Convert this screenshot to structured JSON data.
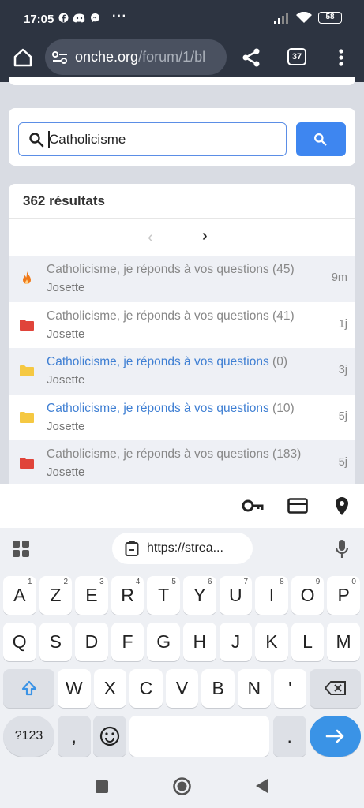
{
  "status_bar": {
    "time": "17:05",
    "battery": "58",
    "notification_icons": [
      "facebook-icon",
      "discord-icon",
      "messenger-icon"
    ],
    "more": "···"
  },
  "browser": {
    "url_host": "onche.org",
    "url_path": "/forum/1/bl",
    "tab_count": "37"
  },
  "search": {
    "value": "Catholicisme"
  },
  "results": {
    "count_label": "362 résultats",
    "pager_prev": "‹",
    "pager_next": "›",
    "topics": [
      {
        "icon": "fire-icon",
        "color": "#f07a1a",
        "title": "Catholicisme, je réponds à vos questions",
        "count": "(45)",
        "author": "Josette",
        "age": "9m",
        "unread": false
      },
      {
        "icon": "folder-red-icon",
        "color": "#e0443a",
        "title": "Catholicisme, je réponds à vos questions",
        "count": "(41)",
        "author": "Josette",
        "age": "1j",
        "unread": false
      },
      {
        "icon": "folder-yellow-icon",
        "color": "#f5c842",
        "title": "Catholicisme, je réponds à vos questions",
        "count": "(0)",
        "author": "Josette",
        "age": "3j",
        "unread": true
      },
      {
        "icon": "folder-yellow-icon",
        "color": "#f5c842",
        "title": "Catholicisme, je réponds à vos questions",
        "count": "(10)",
        "author": "Josette",
        "age": "5j",
        "unread": true
      },
      {
        "icon": "folder-red-icon",
        "color": "#e0443a",
        "title": "Catholicisme, je réponds à vos questions",
        "count": "(183)",
        "author": "Josette",
        "age": "5j",
        "unread": false
      }
    ]
  },
  "keyboard": {
    "clipboard_chip": "https://strea...",
    "row1": [
      {
        "k": "A",
        "h": "1"
      },
      {
        "k": "Z",
        "h": "2"
      },
      {
        "k": "E",
        "h": "3"
      },
      {
        "k": "R",
        "h": "4"
      },
      {
        "k": "T",
        "h": "5"
      },
      {
        "k": "Y",
        "h": "6"
      },
      {
        "k": "U",
        "h": "7"
      },
      {
        "k": "I",
        "h": "8"
      },
      {
        "k": "O",
        "h": "9"
      },
      {
        "k": "P",
        "h": "0"
      }
    ],
    "row2": [
      "Q",
      "S",
      "D",
      "F",
      "G",
      "H",
      "J",
      "K",
      "L",
      "M"
    ],
    "row3": [
      "W",
      "X",
      "C",
      "V",
      "B",
      "N",
      "'"
    ],
    "symbols_key": "?123",
    "comma_key": ",",
    "period_key": "."
  },
  "colors": {
    "toolbar": "#2d3441",
    "accent": "#3e86f0",
    "link": "#3f7fd3"
  }
}
